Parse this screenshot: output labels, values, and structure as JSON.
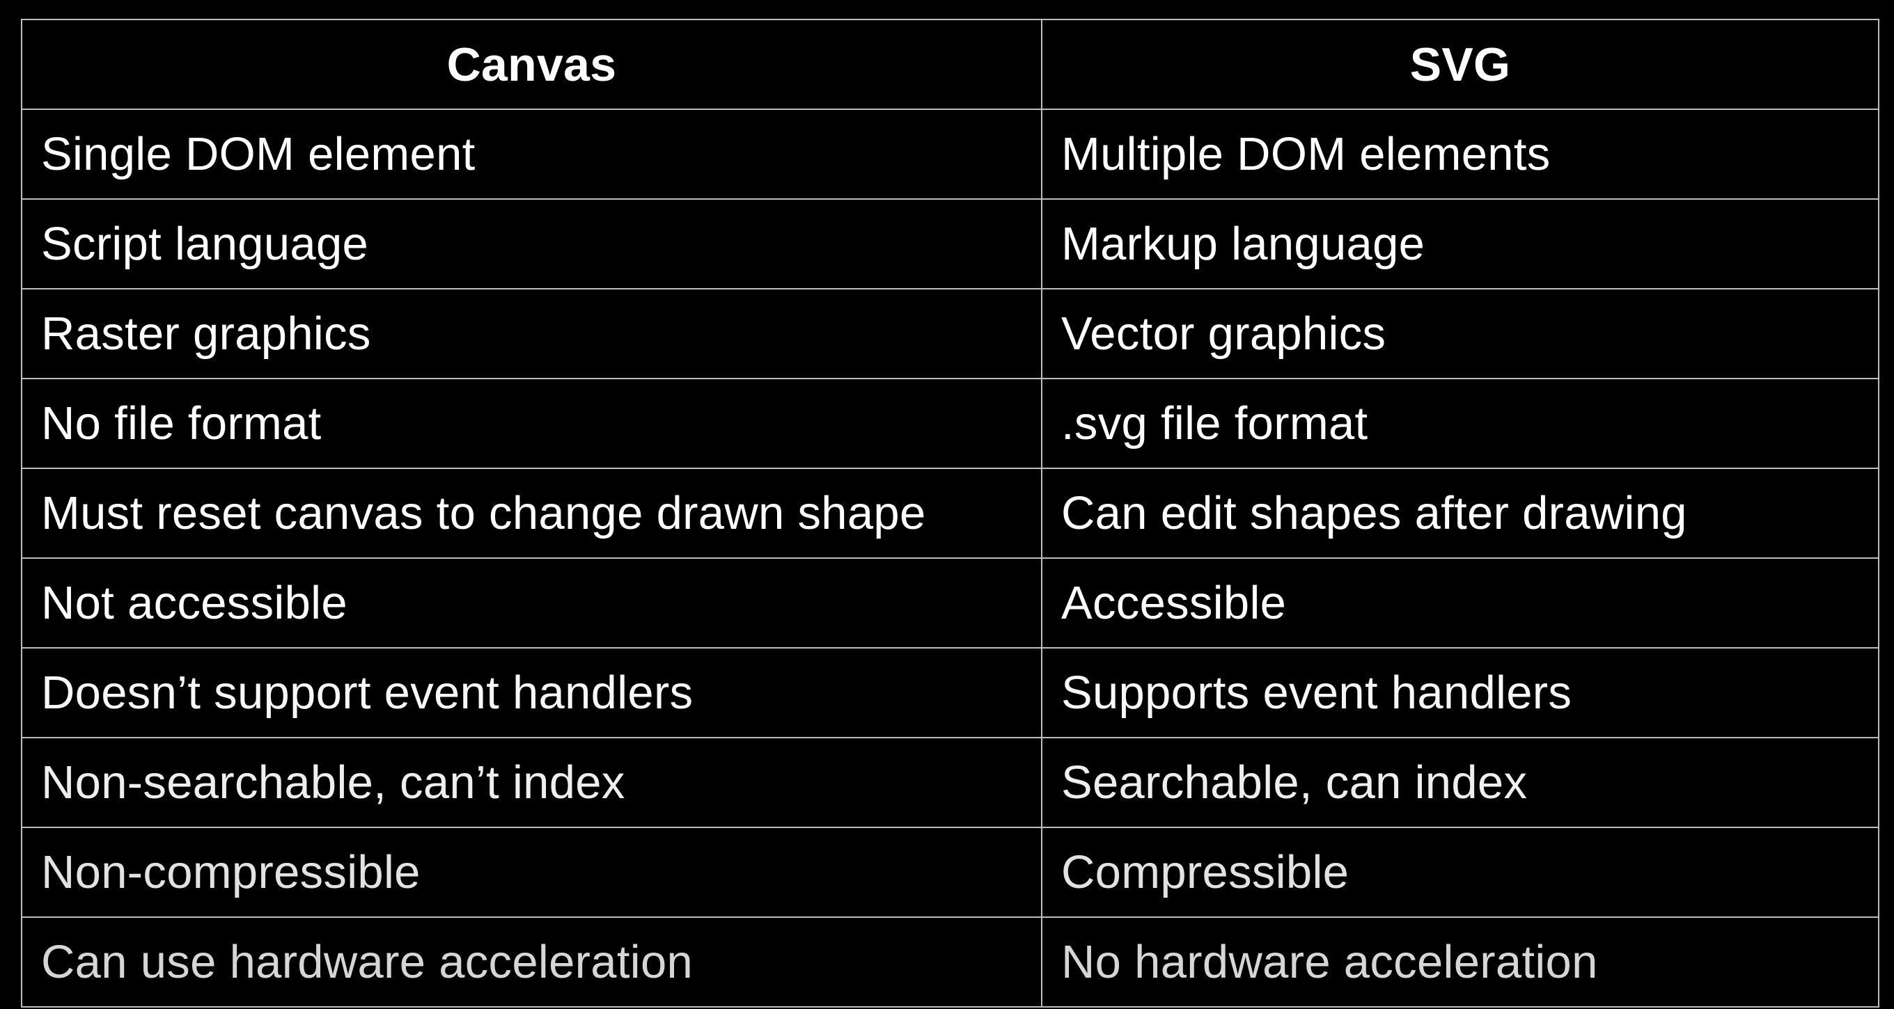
{
  "table": {
    "headers": [
      "Canvas",
      "SVG"
    ],
    "rows": [
      {
        "canvas": "Single DOM element",
        "svg": "Multiple DOM elements",
        "color": "#ffffff"
      },
      {
        "canvas": "Script language",
        "svg": "Markup language",
        "color": "#ffffff"
      },
      {
        "canvas": "Raster graphics",
        "svg": "Vector graphics",
        "color": "#ffffff"
      },
      {
        "canvas": "No file format",
        "svg": ".svg file format",
        "color": "#ffffff"
      },
      {
        "canvas": "Must reset canvas to change drawn shape",
        "svg": "Can edit shapes after drawing",
        "color": "#ffffff"
      },
      {
        "canvas": "Not accessible",
        "svg": "Accessible",
        "color": "#ffffff"
      },
      {
        "canvas": "Doesn’t support event handlers",
        "svg": "Supports event handlers",
        "color": "#f7f7f7"
      },
      {
        "canvas": "Non-searchable, can’t index",
        "svg": "Searchable, can index",
        "color": "#eeeeee"
      },
      {
        "canvas": "Non-compressible",
        "svg": "Compressible",
        "color": "#e2e2e2"
      },
      {
        "canvas": "Can use hardware acceleration",
        "svg": "No hardware acceleration",
        "color": "#d6d6d6"
      }
    ]
  }
}
